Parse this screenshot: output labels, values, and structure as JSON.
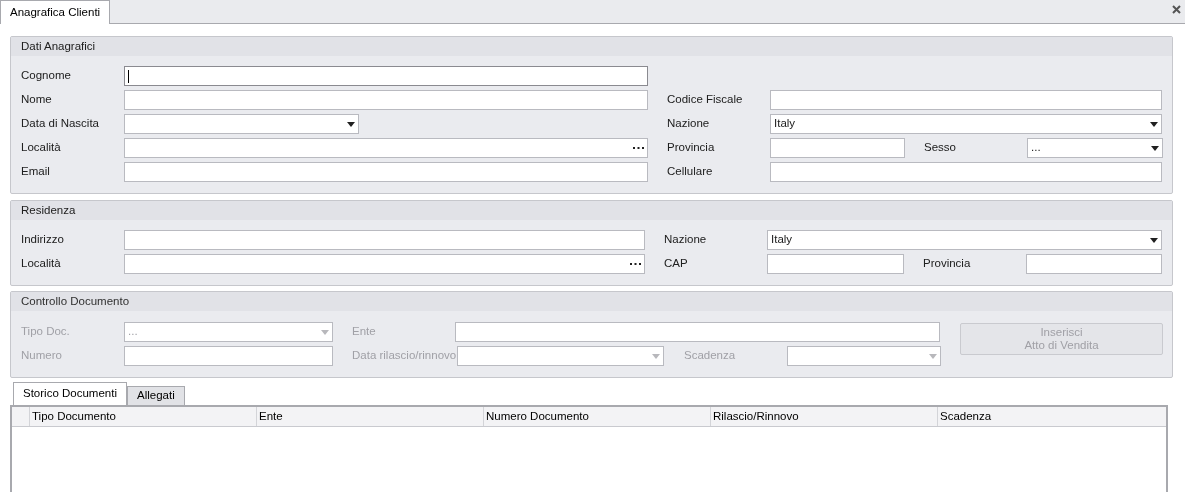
{
  "tab": {
    "label": "Anagrafica Clienti",
    "selected": true
  },
  "dati_anagrafici": {
    "title": "Dati Anagrafici",
    "cognome": {
      "label": "Cognome",
      "focused": true
    },
    "nome": {
      "label": "Nome",
      "focused": false
    },
    "codice_fiscale": {
      "label": "Codice Fiscale",
      "focused": false
    },
    "data_di_nascita": {
      "label": "Data di Nascita",
      "focused": false
    },
    "nazione": {
      "label": "Nazione",
      "value": "Italy",
      "focused": false
    },
    "localita": {
      "label": "Località",
      "focused": false
    },
    "provincia": {
      "label": "Provincia",
      "focused": false
    },
    "sesso": {
      "label": "Sesso",
      "value": "...",
      "focused": false
    },
    "email": {
      "label": "Email",
      "focused": false
    },
    "cellulare": {
      "label": "Cellulare",
      "focused": false
    }
  },
  "residenza": {
    "title": "Residenza",
    "indirizzo": {
      "label": "Indirizzo",
      "focused": false
    },
    "nazione": {
      "label": "Nazione",
      "value": "Italy",
      "focused": false
    },
    "localita": {
      "label": "Località",
      "focused": false
    },
    "cap": {
      "label": "CAP",
      "focused": false
    },
    "provincia": {
      "label": "Provincia",
      "focused": false
    }
  },
  "controllo_documento": {
    "title": "Controllo Documento",
    "disabled": true,
    "tipo_doc": {
      "label": "Tipo Doc.",
      "value": "...",
      "focused": false
    },
    "ente": {
      "label": "Ente",
      "focused": false
    },
    "numero": {
      "label": "Numero",
      "focused": false
    },
    "data_rilascio": {
      "label": "Data rilascio/rinnovo",
      "focused": false
    },
    "scadenza": {
      "label": "Scadenza",
      "focused": false
    },
    "button": {
      "lines": [
        "Inserisci",
        "Atto di Vendita"
      ],
      "disabled": true
    }
  },
  "bottom_tabs": [
    {
      "label": "Storico Documenti",
      "selected": true
    },
    {
      "label": "Allegati",
      "selected": false
    }
  ],
  "table": {
    "columns": [
      "Tipo Documento",
      "Ente",
      "Numero Documento",
      "Rilascio/Rinnovo",
      "Scadenza"
    ]
  }
}
